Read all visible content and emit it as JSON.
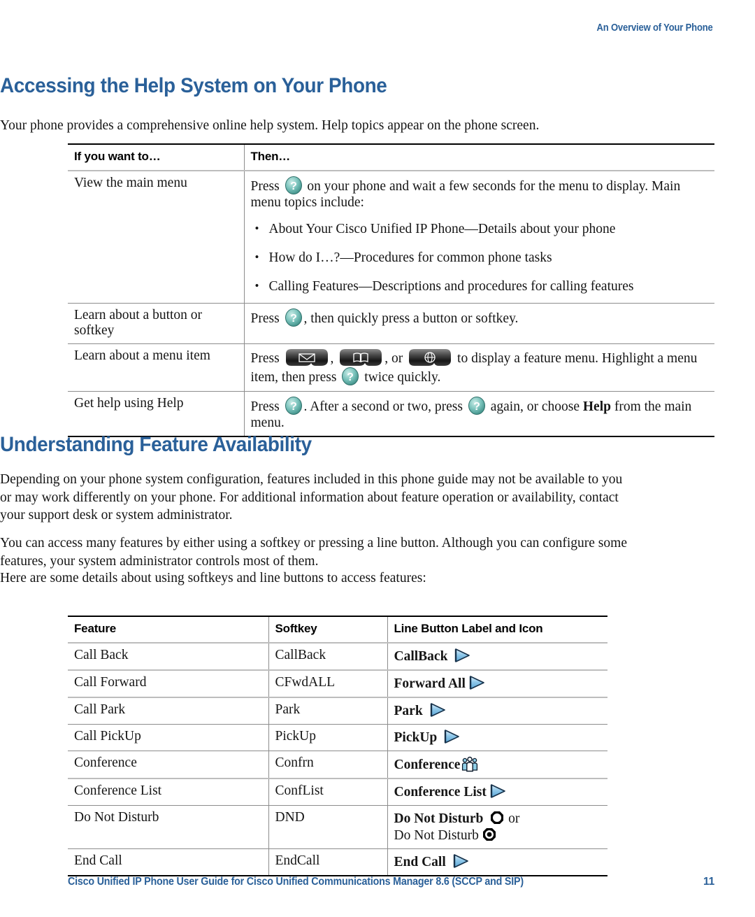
{
  "running_head": "An Overview of Your Phone",
  "accent_color": "#2A6099",
  "sections": {
    "help": {
      "heading": "Accessing the Help System on Your Phone",
      "intro": "Your phone provides a comprehensive online help system. Help topics appear on the phone screen.",
      "table": {
        "headers": [
          "If you want to…",
          "Then…"
        ],
        "rows": [
          {
            "want": "View the main menu",
            "then_pre": "Press",
            "then_post": "on your phone and wait a few seconds for the menu to display. Main menu topics include:",
            "bullets": [
              "About Your Cisco Unified IP Phone—Details about your phone",
              "How do I…?—Procedures for common phone tasks",
              "Calling Features—Descriptions and procedures for calling features"
            ]
          },
          {
            "want": "Learn about a button or softkey",
            "then_pre": "Press",
            "then_post": ", then quickly press a button or softkey."
          },
          {
            "want": "Learn about a menu item",
            "then_pre": "Press",
            "then_mid1": ",",
            "then_mid2": ", or",
            "then_mid3": "to display a feature menu. Highlight a menu item, then press",
            "then_post": "twice quickly."
          },
          {
            "want": "Get help using Help",
            "then_pre": "Press",
            "then_mid1": ". After a second or two, press",
            "then_mid2": "again, or choose",
            "then_bold": "Help",
            "then_post": "from the main menu."
          }
        ]
      }
    },
    "feature": {
      "heading": "Understanding Feature Availability",
      "paragraphs": [
        "Depending on your phone system configuration, features included in this phone guide may not be available to you or may work differently on your phone. For additional information about feature operation or availability, contact your support desk or system administrator.",
        "You can access many features by either using a softkey or pressing a line button. Although you can configure some features, your system administrator controls most of them.",
        "Here are some details about using softkeys and line buttons to access features:"
      ],
      "table": {
        "headers": [
          "Feature",
          "Softkey",
          "Line Button Label and Icon"
        ],
        "rows": [
          {
            "feature": "Call Back",
            "softkey": "CallBack",
            "line_label": "CallBack",
            "icon": "arrow-right-icon"
          },
          {
            "feature": "Call Forward",
            "softkey": "CFwdALL",
            "line_label": "Forward All",
            "icon": "arrow-right-icon"
          },
          {
            "feature": "Call Park",
            "softkey": "Park",
            "line_label": "Park",
            "icon": "arrow-right-icon"
          },
          {
            "feature": "Call PickUp",
            "softkey": "PickUp",
            "line_label": "PickUp",
            "icon": "arrow-right-icon"
          },
          {
            "feature": "Conference",
            "softkey": "Confrn",
            "line_label": "Conference",
            "icon": "conference-people-icon"
          },
          {
            "feature": "Conference List",
            "softkey": "ConfList",
            "line_label": "Conference List",
            "icon": "arrow-right-icon"
          },
          {
            "feature": "Do Not Disturb",
            "softkey": "DND",
            "line_label": "Do Not Disturb",
            "icon": "dnd-outline-icon",
            "line_label_or": "or",
            "line_label_2": "Do Not Disturb",
            "icon2": "dnd-filled-icon"
          },
          {
            "feature": "End Call",
            "softkey": "EndCall",
            "line_label": "End Call",
            "icon": "arrow-right-icon"
          }
        ]
      }
    }
  },
  "icons": {
    "help": "help-question-icon",
    "messages": "messages-envelope-icon",
    "directories": "directories-book-icon",
    "services": "services-globe-icon"
  },
  "footer": {
    "title": "Cisco Unified IP Phone User Guide for Cisco Unified Communications Manager 8.6 (SCCP and SIP)",
    "page": "11"
  }
}
